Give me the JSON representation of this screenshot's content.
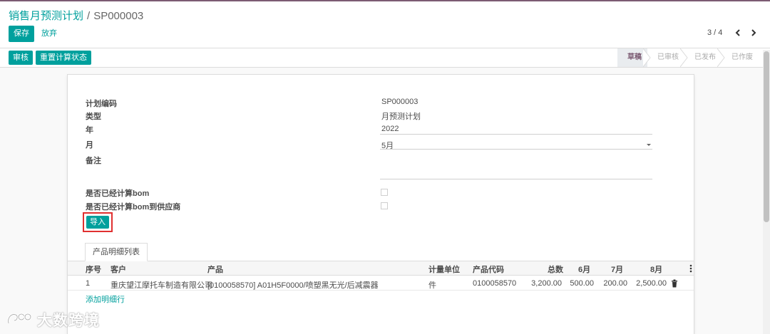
{
  "breadcrumb": {
    "parent": "销售月预测计划",
    "separator": "/",
    "current": "SP000003"
  },
  "toolbar": {
    "save_label": "保存",
    "discard_label": "放弃"
  },
  "pager": {
    "text": "3 / 4"
  },
  "statusbar": {
    "buttons": {
      "audit": "审核",
      "recalc": "重置计算状态"
    },
    "stages": [
      {
        "label": "草稿",
        "active": true
      },
      {
        "label": "已审核",
        "active": false
      },
      {
        "label": "已发布",
        "active": false
      },
      {
        "label": "已作废",
        "active": false
      }
    ]
  },
  "form": {
    "plan_code": {
      "label": "计划编码",
      "value": "SP000003"
    },
    "type": {
      "label": "类型",
      "value": "月预测计划"
    },
    "year": {
      "label": "年",
      "value": "2022"
    },
    "month": {
      "label": "月",
      "value": "5月"
    },
    "note": {
      "label": "备注",
      "value": ""
    },
    "bom_calculated": {
      "label": "是否已经计算bom",
      "checked": false
    },
    "bom_to_supplier": {
      "label": "是否已经计算bom到供应商",
      "checked": false
    },
    "import_label": "导入"
  },
  "tab": {
    "label": "产品明细列表"
  },
  "table": {
    "headers": {
      "seq": "序号",
      "customer": "客户",
      "product": "产品",
      "uom": "计量单位",
      "code": "产品代码",
      "total": "总数",
      "m6": "6月",
      "m7": "7月",
      "m8": "8月"
    },
    "rows": [
      {
        "seq": "1",
        "customer": "重庆望江摩托车制造有限公司",
        "product": "[0100058570] A01H5F0000/喷塑黑无光/后减震器",
        "uom": "件",
        "code": "0100058570",
        "total": "3,200.00",
        "m6": "500.00",
        "m7": "200.00",
        "m8": "2,500.00"
      }
    ],
    "add_line": "添加明细行"
  },
  "watermark": {
    "text": "大数跨境"
  },
  "colors": {
    "accent": "#00a09d",
    "brand": "#7c5b73",
    "highlight_border": "#e03030"
  }
}
